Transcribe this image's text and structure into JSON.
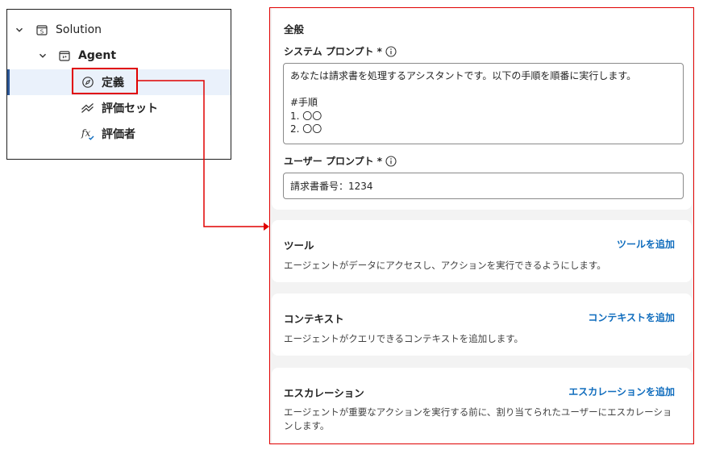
{
  "tree": {
    "items": [
      {
        "label": "Solution",
        "icon": "solution-icon",
        "expanded": true
      },
      {
        "label": "Agent",
        "icon": "agent-icon",
        "expanded": true
      },
      {
        "label": "定義",
        "icon": "compass-icon",
        "selected": true
      },
      {
        "label": "評価セット",
        "icon": "evaluation-set-icon"
      },
      {
        "label": "評価者",
        "icon": "function-evaluator-icon"
      }
    ]
  },
  "general": {
    "title": "全般",
    "system_prompt": {
      "label": "システム プロンプト *",
      "value": "あなたは請求書を処理するアシスタントです。以下の手順を順番に実行します。\n\n#手順\n1. 〇〇\n2. 〇〇"
    },
    "user_prompt": {
      "label": "ユーザー プロンプト *",
      "value": "請求書番号：1234"
    }
  },
  "tools": {
    "title": "ツール",
    "add_label": "ツールを追加",
    "description": "エージェントがデータにアクセスし、アクションを実行できるようにします。"
  },
  "context": {
    "title": "コンテキスト",
    "add_label": "コンテキストを追加",
    "description": "エージェントがクエリできるコンテキストを追加します。"
  },
  "escalation": {
    "title": "エスカレーション",
    "add_label": "エスカレーションを追加",
    "description": "エージェントが重要なアクションを実行する前に、割り当てられたユーザーにエスカレーションします。"
  },
  "colors": {
    "highlight": "#e00000",
    "link": "#0f6cbd",
    "selected_bg": "#eaf1fb"
  }
}
